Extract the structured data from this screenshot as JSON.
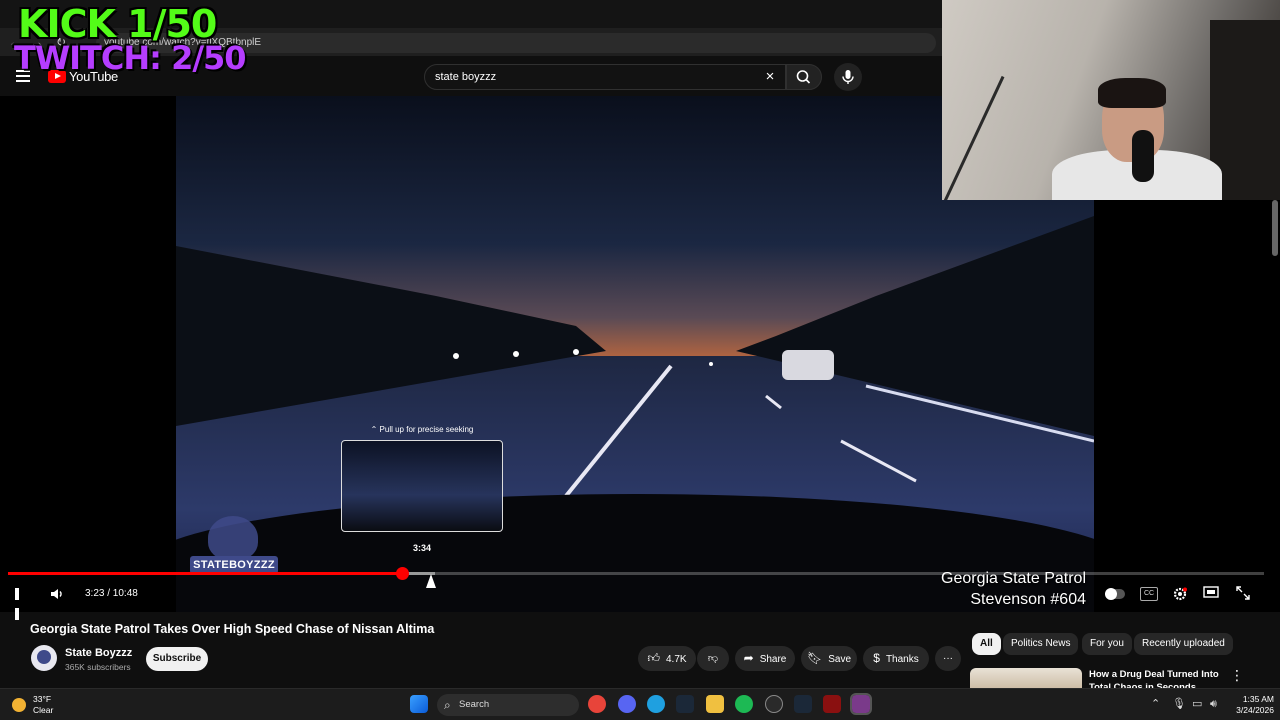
{
  "browser": {
    "url": "youtube.com/watch?v=tlXQBtbnplE"
  },
  "overlay": {
    "kick_label": "KICK 1/50",
    "twitch_label": "TWITCH: 2/50"
  },
  "masthead": {
    "logo_text": "YouTube",
    "search_value": "state boyzzz"
  },
  "player": {
    "seek_hint": "Pull up for precise seeking",
    "preview_time": "3:34",
    "current_time": "3:23",
    "duration": "10:48",
    "time_display": "3:23 / 10:48",
    "progress_fraction": 0.314,
    "buffered_fraction": 0.34,
    "watermark_text": "STATEBOYZZZ",
    "caption_line1": "Georgia State Patrol",
    "caption_line2": "Stevenson #604",
    "icons": {
      "play_state": "pause-icon",
      "volume": "volume-icon",
      "autoplay": "autoplay-toggle-icon",
      "subtitles": "subtitles-icon",
      "settings": "settings-gear-icon",
      "theater": "theater-mode-icon",
      "fullscreen": "fullscreen-icon"
    },
    "cc_label": "CC"
  },
  "video": {
    "title": "Georgia State Patrol Takes Over High Speed Chase of Nissan Altima",
    "channel_name": "State Boyzzz",
    "subscribers": "365K subscribers",
    "subscribe_label": "Subscribe",
    "like_count": "4.7K",
    "share_label": "Share",
    "save_label": "Save",
    "thanks_label": "Thanks"
  },
  "recommendations": {
    "chips": [
      "All",
      "Politics News",
      "For you",
      "Recently uploaded"
    ],
    "active_chip": 0,
    "first_item_title": "How a Drug Deal Turned Into Total Chaos in Seconds"
  },
  "taskbar": {
    "temperature": "33°F",
    "condition": "Clear",
    "search_placeholder": "Search",
    "time": "1:35 AM",
    "date": "3/24/2026"
  },
  "colors": {
    "accent_red": "#ff0000",
    "kick_green": "#53fc18",
    "twitch_purple": "#b53dff",
    "background": "#0f0f0f"
  }
}
